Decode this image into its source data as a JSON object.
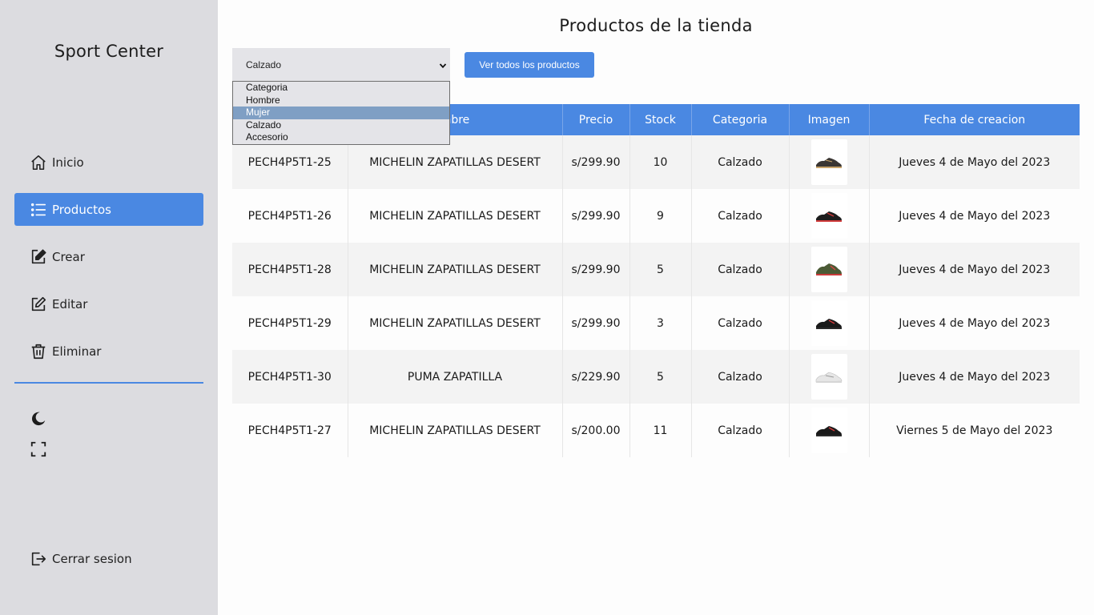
{
  "sidebar": {
    "brand": "Sport Center",
    "items": [
      {
        "label": "Inicio",
        "icon": "home-icon",
        "active": false
      },
      {
        "label": "Productos",
        "icon": "list-icon",
        "active": true
      },
      {
        "label": "Crear",
        "icon": "create-icon",
        "active": false
      },
      {
        "label": "Editar",
        "icon": "edit-icon",
        "active": false
      },
      {
        "label": "Eliminar",
        "icon": "trash-icon",
        "active": false
      }
    ],
    "utilities": [
      "moon-icon",
      "fullscreen-icon"
    ],
    "logout_label": "Cerrar sesion",
    "logout_icon": "logout-icon"
  },
  "main": {
    "title": "Productos de la tienda",
    "filter": {
      "selected": "Calzado",
      "options": [
        "Categoria",
        "Hombre",
        "Mujer",
        "Calzado",
        "Accesorio"
      ],
      "highlighted": "Mujer"
    },
    "view_all_label": "Ver todos los productos",
    "table": {
      "headers": [
        "",
        "mbre",
        "Precio",
        "Stock",
        "Categoria",
        "Imagen",
        "Fecha de creacion"
      ],
      "rows": [
        {
          "code": "PECH4P5T1-25",
          "name": "MICHELIN ZAPATILLAS DESERT",
          "price": "s/299.90",
          "stock": "10",
          "category": "Calzado",
          "image": "shoe-beige",
          "date": "Jueves 4 de Mayo del 2023"
        },
        {
          "code": "PECH4P5T1-26",
          "name": "MICHELIN ZAPATILLAS DESERT",
          "price": "s/299.90",
          "stock": "9",
          "category": "Calzado",
          "image": "shoe-red-black",
          "date": "Jueves 4 de Mayo del 2023"
        },
        {
          "code": "PECH4P5T1-28",
          "name": "MICHELIN ZAPATILLAS DESERT",
          "price": "s/299.90",
          "stock": "5",
          "category": "Calzado",
          "image": "shoe-olive",
          "date": "Jueves 4 de Mayo del 2023"
        },
        {
          "code": "PECH4P5T1-29",
          "name": "MICHELIN ZAPATILLAS DESERT",
          "price": "s/299.90",
          "stock": "3",
          "category": "Calzado",
          "image": "shoe-black-red",
          "date": "Jueves 4 de Mayo del 2023"
        },
        {
          "code": "PECH4P5T1-30",
          "name": "PUMA ZAPATILLA",
          "price": "s/229.90",
          "stock": "5",
          "category": "Calzado",
          "image": "shoe-white",
          "date": "Jueves 4 de Mayo del 2023"
        },
        {
          "code": "PECH4P5T1-27",
          "name": "MICHELIN ZAPATILLAS DESERT",
          "price": "s/200.00",
          "stock": "11",
          "category": "Calzado",
          "image": "shoe-black-red",
          "date": "Viernes 5 de Mayo del 2023"
        }
      ]
    }
  },
  "colors": {
    "accent": "#4a88e2",
    "sidebar_bg": "#dcdce0",
    "dropdown_highlight": "#7f9fc4"
  }
}
